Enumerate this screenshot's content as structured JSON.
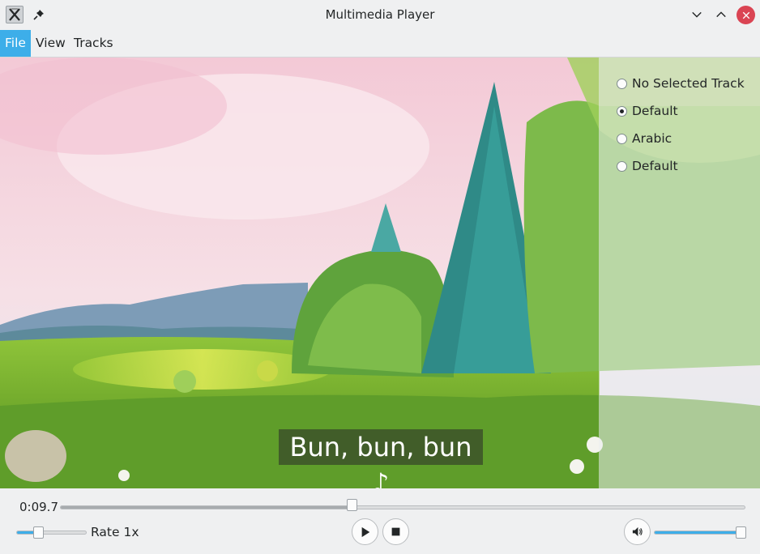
{
  "window": {
    "title": "Multimedia Player",
    "app_icon": "x-logo-icon",
    "pin_icon": "pin-icon",
    "controls": [
      "minimize-icon",
      "maximize-icon",
      "close-icon"
    ],
    "close_color": "#da4453"
  },
  "menubar": {
    "items": [
      {
        "label": "File",
        "active": true
      },
      {
        "label": "View",
        "active": false
      },
      {
        "label": "Tracks",
        "active": false
      }
    ],
    "accent": "#3daee9"
  },
  "video": {
    "subtitle": "Bun, bun, bun ♪"
  },
  "tracks_panel": {
    "options": [
      {
        "label": "No Selected Track",
        "selected": false
      },
      {
        "label": "Default",
        "selected": true
      },
      {
        "label": "Arabic",
        "selected": false
      },
      {
        "label": "Default",
        "selected": false
      }
    ]
  },
  "controls": {
    "time": "0:09.7",
    "seek_progress": 0.425,
    "rate_label": "Rate 1x",
    "rate_progress": 0.28,
    "volume_progress": 1.0,
    "play_icon": "play-icon",
    "stop_icon": "stop-icon",
    "volume_icon": "speaker-icon"
  }
}
